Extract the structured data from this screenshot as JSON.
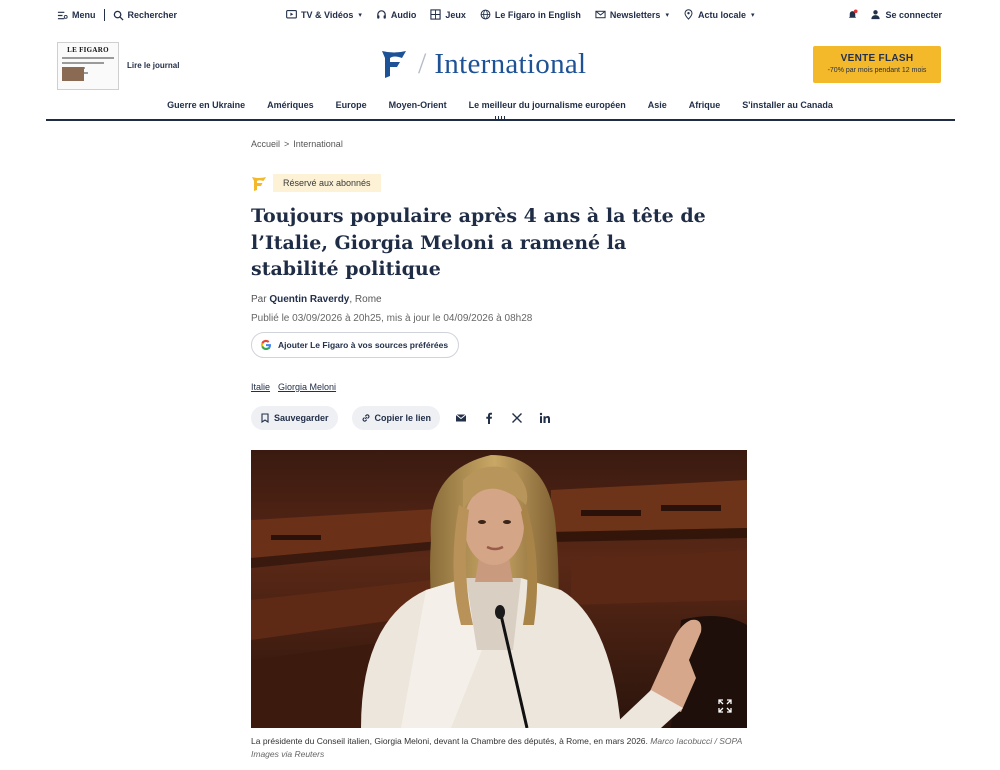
{
  "topbar": {
    "menu": "Menu",
    "search": "Rechercher",
    "tv": "TV & Vidéos",
    "audio": "Audio",
    "games": "Jeux",
    "english": "Le Figaro in English",
    "newsletters": "Newsletters",
    "local": "Actu locale",
    "login": "Se connecter"
  },
  "header": {
    "journal_masthead": "LE FIGARO",
    "read_journal": "Lire le journal",
    "section": "International",
    "flash_title": "VENTE FLASH",
    "flash_sub": "-70% par mois pendant 12 mois"
  },
  "nav": {
    "items": [
      "Guerre en Ukraine",
      "Amériques",
      "Europe",
      "Moyen-Orient",
      "Le meilleur du journalisme européen",
      "Asie",
      "Afrique",
      "S'installer au Canada"
    ]
  },
  "article": {
    "breadcrumb": [
      "Accueil",
      ">",
      "International"
    ],
    "premium_badge": "Réservé aux abonnés",
    "headline": "Toujours populaire après 4 ans à la tête de l’Italie, Giorgia Meloni a ramené la stabilité politique",
    "byline_prefix": "Par",
    "author": "Quentin Raverdy",
    "location": ", Rome",
    "dates": "Publié le 03/09/2026 à 20h25, mis à jour le 04/09/2026 à 08h28",
    "google_cta": "Ajouter Le Figaro à vos sources préférées",
    "tags": [
      "Italie",
      "Giorgia Meloni"
    ],
    "save": "Sauvegarder",
    "copy_link": "Copier le lien",
    "caption": "La présidente du Conseil italien, Giorgia Meloni, devant la Chambre des députés, à Rome, en mars 2026.",
    "credit": "Marco Iacobucci / SOPA Images via Reuters"
  },
  "icons": {
    "menu": "menu-icon",
    "search": "search-icon",
    "tv": "tv-icon",
    "audio": "headphones-icon",
    "games": "game-icon",
    "english": "globe-icon",
    "newsletters": "mail-icon",
    "local": "location-pin-icon",
    "notifications": "bell-icon",
    "user": "user-icon",
    "save": "bookmark-icon",
    "link": "link-icon",
    "share": [
      "email-icon",
      "facebook-icon",
      "x-icon",
      "linkedin-icon"
    ],
    "expand": "expand-icon"
  },
  "colors": {
    "brand_navy": "#1f2c45",
    "section_blue": "#1e5296",
    "flash_yellow": "#f4b92a",
    "premium_bg": "#fdf1d6",
    "notification_red": "#e0322f"
  }
}
